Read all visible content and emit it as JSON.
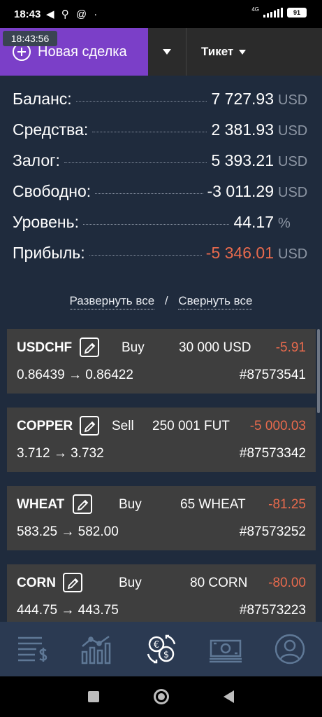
{
  "status_bar": {
    "time": "18:43",
    "left_icons": "◀ ⚲ @ ·",
    "network": "4G",
    "battery": "91"
  },
  "overlay_time": "18:43:56",
  "toolbar": {
    "new_deal_label": "Новая сделка",
    "ticket_label": "Тикет"
  },
  "summary": [
    {
      "label": "Баланс:",
      "value": "7 727.93",
      "unit": "USD",
      "negative": false
    },
    {
      "label": "Средства:",
      "value": "2 381.93",
      "unit": "USD",
      "negative": false
    },
    {
      "label": "Залог:",
      "value": "5 393.21",
      "unit": "USD",
      "negative": false
    },
    {
      "label": "Свободно:",
      "value": "-3 011.29",
      "unit": "USD",
      "negative": false
    },
    {
      "label": "Уровень:",
      "value": "44.17",
      "unit": "%",
      "negative": false
    },
    {
      "label": "Прибыль:",
      "value": "-5 346.01",
      "unit": "USD",
      "negative": true
    }
  ],
  "expand_links": {
    "expand_all": "Развернуть все",
    "separator": "/",
    "collapse_all": "Свернуть все"
  },
  "positions": [
    {
      "symbol": "USDCHF",
      "side": "Buy",
      "volume": "30 000 USD",
      "pnl": "-5.91",
      "price": "0.86439 → 0.86422",
      "ticket": "#87573541"
    },
    {
      "symbol": "COPPER",
      "side": "Sell",
      "volume": "250 001 FUT",
      "pnl": "-5 000.03",
      "price": "3.712 → 3.732",
      "ticket": "#87573342"
    },
    {
      "symbol": "WHEAT",
      "side": "Buy",
      "volume": "65 WHEAT",
      "pnl": "-81.25",
      "price": "583.25 → 582.00",
      "ticket": "#87573252"
    },
    {
      "symbol": "CORN",
      "side": "Buy",
      "volume": "80 CORN",
      "pnl": "-80.00",
      "price": "444.75 → 443.75",
      "ticket": "#87573223"
    }
  ],
  "bottom_nav": [
    {
      "icon": "account-statement-icon"
    },
    {
      "icon": "chart-icon"
    },
    {
      "icon": "currency-exchange-icon"
    },
    {
      "icon": "banknote-icon"
    },
    {
      "icon": "profile-icon"
    }
  ],
  "colors": {
    "accent": "#7b3fc8",
    "negative": "#e86a4d",
    "background": "#1f2b3d",
    "nav_background": "#2b3a52"
  }
}
